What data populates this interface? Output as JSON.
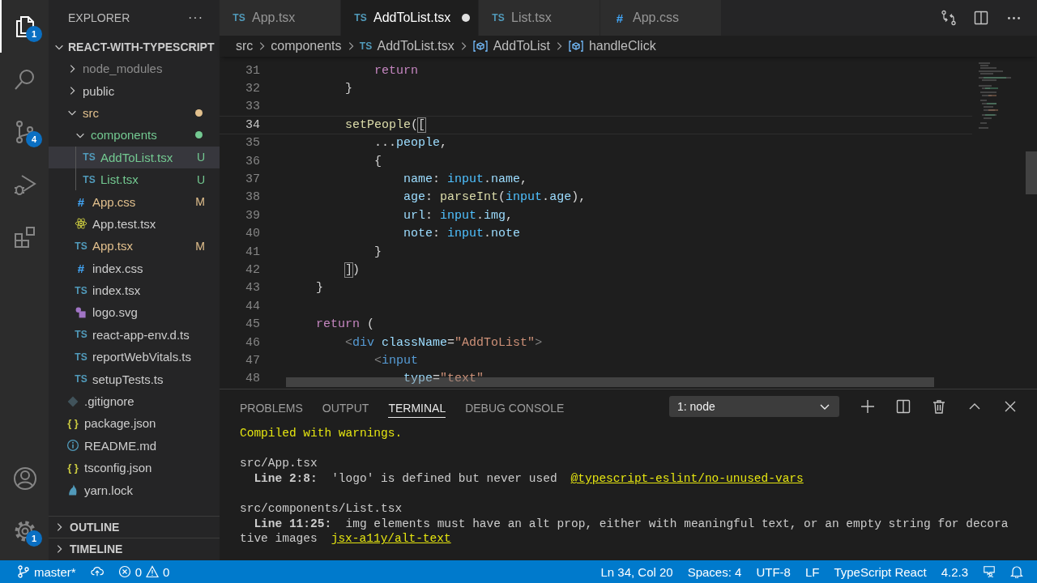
{
  "activity_bar": {
    "top": [
      {
        "kind": "files",
        "selected": true,
        "badge": "1"
      },
      {
        "kind": "search",
        "selected": false
      },
      {
        "kind": "source-control",
        "selected": false,
        "badge": "4"
      },
      {
        "kind": "run",
        "selected": false
      },
      {
        "kind": "extensions",
        "selected": false
      }
    ],
    "bottom": [
      {
        "kind": "account",
        "selected": false
      },
      {
        "kind": "settings",
        "selected": false,
        "badge": "1"
      }
    ]
  },
  "sidebar": {
    "title": "EXPLORER",
    "more": "···",
    "project": {
      "name": "REACT-WITH-TYPESCRIPT",
      "expanded": true
    },
    "tree": [
      {
        "name": "node_modules",
        "kind": "folder",
        "expanded": false,
        "color": "#8c8c8c",
        "dot": false,
        "selected": false
      },
      {
        "name": "public",
        "kind": "folder",
        "expanded": false,
        "color": "#cccccc",
        "dot": false,
        "selected": false
      },
      {
        "name": "src",
        "kind": "folder",
        "expanded": true,
        "color": "#e2c08d",
        "dot": true,
        "selected": false,
        "children": [
          {
            "name": "components",
            "kind": "folder",
            "expanded": true,
            "color": "#73c991",
            "dot": true,
            "selected": false,
            "children": [
              {
                "name": "AddToList.tsx",
                "kind": "ts",
                "icon": "TS",
                "color": "#73c991",
                "status": "U",
                "selected": true
              },
              {
                "name": "List.tsx",
                "kind": "ts",
                "icon": "TS",
                "color": "#73c991",
                "status": "U",
                "selected": false
              }
            ]
          },
          {
            "name": "App.css",
            "kind": "css",
            "icon": "#",
            "color": "#e2c08d",
            "status": "M",
            "selected": false
          },
          {
            "name": "App.test.tsx",
            "kind": "react",
            "color": "#cccccc",
            "selected": false
          },
          {
            "name": "App.tsx",
            "kind": "ts",
            "icon": "TS",
            "color": "#e2c08d",
            "status": "M",
            "selected": false
          },
          {
            "name": "index.css",
            "kind": "css",
            "icon": "#",
            "color": "#cccccc",
            "selected": false
          },
          {
            "name": "index.tsx",
            "kind": "ts",
            "icon": "TS",
            "color": "#cccccc",
            "selected": false
          },
          {
            "name": "logo.svg",
            "kind": "svg",
            "color": "#cccccc",
            "selected": false
          },
          {
            "name": "react-app-env.d.ts",
            "kind": "ts",
            "icon": "TS",
            "color": "#cccccc",
            "selected": false
          },
          {
            "name": "reportWebVitals.ts",
            "kind": "ts",
            "icon": "TS",
            "color": "#cccccc",
            "selected": false
          },
          {
            "name": "setupTests.ts",
            "kind": "ts",
            "icon": "TS",
            "color": "#cccccc",
            "selected": false
          }
        ]
      },
      {
        "name": ".gitignore",
        "kind": "git",
        "color": "#cccccc",
        "selected": false
      },
      {
        "name": "package.json",
        "kind": "json",
        "icon": "{ }",
        "color": "#cccccc",
        "selected": false
      },
      {
        "name": "README.md",
        "kind": "info",
        "color": "#cccccc",
        "selected": false
      },
      {
        "name": "tsconfig.json",
        "kind": "json",
        "icon": "{ }",
        "color": "#cccccc",
        "selected": false
      },
      {
        "name": "yarn.lock",
        "kind": "yarn",
        "color": "#cccccc",
        "selected": false
      }
    ],
    "sections": [
      {
        "title": "OUTLINE",
        "expanded": false
      },
      {
        "title": "TIMELINE",
        "expanded": false
      }
    ]
  },
  "tabs": [
    {
      "label": "App.tsx",
      "kind": "ts",
      "icon": "TS",
      "selected": false,
      "modified": false
    },
    {
      "label": "AddToList.tsx",
      "kind": "ts",
      "icon": "TS",
      "selected": true,
      "modified": true
    },
    {
      "label": "List.tsx",
      "kind": "ts",
      "icon": "TS",
      "selected": false,
      "modified": false
    },
    {
      "label": "App.css",
      "kind": "css",
      "icon": "#",
      "selected": false,
      "modified": false
    }
  ],
  "breadcrumbs": [
    {
      "kind": "plain",
      "label": "src"
    },
    {
      "kind": "plain",
      "label": "components"
    },
    {
      "kind": "file",
      "icon": "TS",
      "label": "AddToList.tsx"
    },
    {
      "kind": "symbol",
      "label": "AddToList"
    },
    {
      "kind": "symbol",
      "label": "handleClick"
    }
  ],
  "editor": {
    "lines": [
      {
        "number": "31",
        "current": false,
        "tokens": [
          {
            "kind": "keyword",
            "text": "            return"
          }
        ]
      },
      {
        "number": "32",
        "current": false,
        "tokens": [
          {
            "kind": "punct",
            "text": "        }"
          }
        ]
      },
      {
        "number": "33",
        "current": false
      },
      {
        "number": "34",
        "current": true,
        "tokens": [
          {
            "kind": "func",
            "text": "        setPeople"
          },
          {
            "kind": "punct",
            "text": "("
          },
          {
            "kind": "match",
            "text": "["
          }
        ]
      },
      {
        "number": "35",
        "current": false,
        "tokens": [
          {
            "kind": "punct",
            "text": "            ..."
          },
          {
            "kind": "var",
            "text": "people"
          },
          {
            "kind": "punct",
            "text": ","
          }
        ]
      },
      {
        "number": "36",
        "current": false,
        "tokens": [
          {
            "kind": "punct",
            "text": "            {"
          }
        ]
      },
      {
        "number": "37",
        "current": false,
        "tokens": [
          {
            "kind": "var",
            "text": "                name"
          },
          {
            "kind": "punct",
            "text": ": "
          },
          {
            "kind": "obj",
            "text": "input"
          },
          {
            "kind": "punct",
            "text": "."
          },
          {
            "kind": "var",
            "text": "name"
          },
          {
            "kind": "punct",
            "text": ","
          }
        ]
      },
      {
        "number": "38",
        "current": false,
        "tokens": [
          {
            "kind": "var",
            "text": "                age"
          },
          {
            "kind": "punct",
            "text": ": "
          },
          {
            "kind": "func",
            "text": "parseInt"
          },
          {
            "kind": "punct",
            "text": "("
          },
          {
            "kind": "obj",
            "text": "input"
          },
          {
            "kind": "punct",
            "text": "."
          },
          {
            "kind": "var",
            "text": "age"
          },
          {
            "kind": "punct",
            "text": "),"
          }
        ]
      },
      {
        "number": "39",
        "current": false,
        "tokens": [
          {
            "kind": "var",
            "text": "                url"
          },
          {
            "kind": "punct",
            "text": ": "
          },
          {
            "kind": "obj",
            "text": "input"
          },
          {
            "kind": "punct",
            "text": "."
          },
          {
            "kind": "var",
            "text": "img"
          },
          {
            "kind": "punct",
            "text": ","
          }
        ]
      },
      {
        "number": "40",
        "current": false,
        "tokens": [
          {
            "kind": "var",
            "text": "                note"
          },
          {
            "kind": "punct",
            "text": ": "
          },
          {
            "kind": "obj",
            "text": "input"
          },
          {
            "kind": "punct",
            "text": "."
          },
          {
            "kind": "var",
            "text": "note"
          }
        ]
      },
      {
        "number": "41",
        "current": false,
        "tokens": [
          {
            "kind": "punct",
            "text": "            }"
          }
        ]
      },
      {
        "number": "42",
        "current": false,
        "tokens": [
          {
            "kind": "match",
            "text": "        ]"
          },
          {
            "kind": "punct",
            "text": ")"
          }
        ]
      },
      {
        "number": "43",
        "current": false,
        "tokens": [
          {
            "kind": "punct",
            "text": "    }"
          }
        ]
      },
      {
        "number": "44",
        "current": false
      },
      {
        "number": "45",
        "current": false,
        "tokens": [
          {
            "kind": "keyword",
            "text": "    return"
          },
          {
            "kind": "punct",
            "text": " ("
          }
        ]
      },
      {
        "number": "46",
        "current": false,
        "tokens": [
          {
            "kind": "angle",
            "text": "        <"
          },
          {
            "kind": "tag",
            "text": "div"
          },
          {
            "kind": "attr",
            "text": " className"
          },
          {
            "kind": "punct",
            "text": "="
          },
          {
            "kind": "string",
            "text": "\"AddToList\""
          },
          {
            "kind": "angle",
            "text": ">"
          }
        ]
      },
      {
        "number": "47",
        "current": false,
        "tokens": [
          {
            "kind": "angle",
            "text": "            <"
          },
          {
            "kind": "tag",
            "text": "input"
          }
        ]
      },
      {
        "number": "48",
        "current": false,
        "tokens": [
          {
            "kind": "attr",
            "text": "                type"
          },
          {
            "kind": "punct",
            "text": "="
          },
          {
            "kind": "string",
            "text": "\"text\""
          }
        ]
      }
    ]
  },
  "panel": {
    "tabs": [
      {
        "label": "PROBLEMS",
        "selected": false
      },
      {
        "label": "OUTPUT",
        "selected": false
      },
      {
        "label": "TERMINAL",
        "selected": true
      },
      {
        "label": "DEBUG CONSOLE",
        "selected": false
      }
    ],
    "terminal_select": "1: node",
    "terminal": [
      [
        [
          {
            "kind": "warn",
            "text": "Compiled with warnings."
          }
        ]
      ],
      [
        [
          {
            "kind": "plain",
            "text": "src/App.tsx"
          }
        ],
        [
          {
            "kind": "plain",
            "text": "  **Line 2:8:**  'logo' is defined but never used"
          },
          {
            "kind": "rule",
            "text": "@typescript-eslint/no-unused-vars"
          }
        ]
      ],
      [
        [
          {
            "kind": "plain",
            "text": "src/components/List.tsx"
          }
        ],
        [
          {
            "kind": "plain",
            "text": "  **Line 11:25:**  img elements must have an alt prop, either with meaningful text, or an empty string for decora"
          }
        ],
        [
          {
            "kind": "plain",
            "text": "tive images"
          },
          {
            "kind": "rule",
            "text": "jsx-a11y/alt-text"
          }
        ]
      ]
    ]
  },
  "status_bar": {
    "branch": "master*",
    "errors": "0",
    "warnings": "0",
    "items": [
      "Ln 34, Col 20",
      "Spaces: 4",
      "UTF-8",
      "LF",
      "TypeScript React",
      "4.2.3"
    ]
  }
}
